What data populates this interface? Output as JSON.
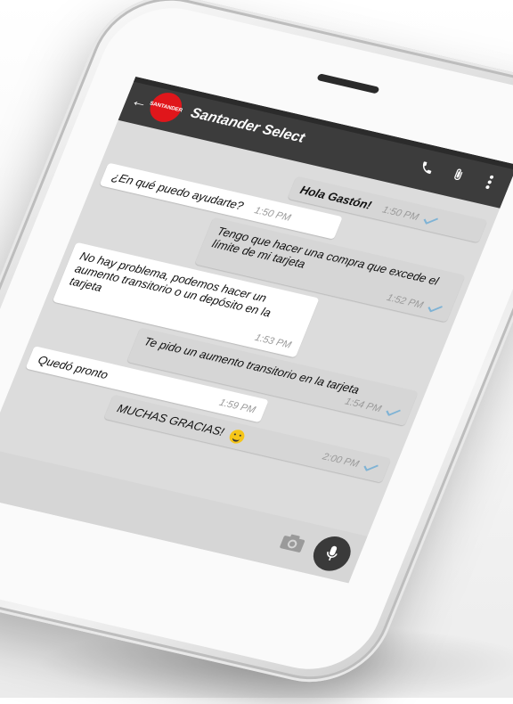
{
  "chat": {
    "contact_name": "Santander Select",
    "avatar_label": "SANTANDER",
    "messages": [
      {
        "id": "m1",
        "direction": "out",
        "text": "Hola Gastón!",
        "time": "1:50 PM",
        "read": true
      },
      {
        "id": "m2",
        "direction": "in",
        "text": "¿En qué puedo ayudarte?",
        "time": "1:50 PM"
      },
      {
        "id": "m3",
        "direction": "out",
        "text": "Tengo que hacer una compra que excede el límite de mi tarjeta",
        "time": "1:52 PM",
        "read": true
      },
      {
        "id": "m4",
        "direction": "in",
        "text": "No hay problema, podemos hacer un aumento transitorio o un depósito en la tarjeta",
        "time": "1:53 PM"
      },
      {
        "id": "m5",
        "direction": "out",
        "text": "Te pido un aumento transitorio en la tarjeta",
        "time": "1:54 PM",
        "read": true
      },
      {
        "id": "m6",
        "direction": "in",
        "text": "Quedó pronto",
        "time": "1:59 PM"
      },
      {
        "id": "m7",
        "direction": "out",
        "text": "MUCHAS GRACIAS!",
        "time": "2:00 PM",
        "read": true,
        "emoji": "smile"
      }
    ]
  },
  "icons": {
    "back": "arrow-left-icon",
    "call": "phone-icon",
    "attach": "paperclip-icon",
    "menu": "more-vert-icon",
    "camera": "camera-icon",
    "mic": "mic-icon",
    "read": "check-icon"
  },
  "colors": {
    "brand": "#e0161b",
    "header": "#3c3c3c",
    "check": "#7fb3d5"
  }
}
